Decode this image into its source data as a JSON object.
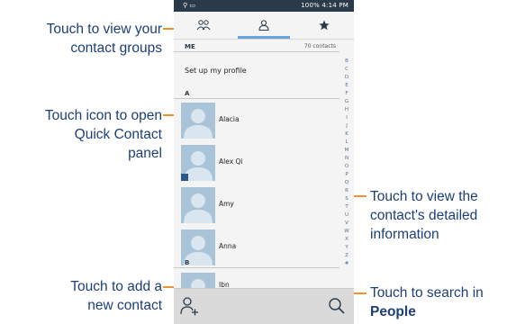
{
  "status_bar": {
    "right_text": "100%  4:14 PM"
  },
  "tabs": [
    {
      "icon": "group-icon",
      "label": "Groups"
    },
    {
      "icon": "person-icon",
      "label": "Contacts",
      "active": true
    },
    {
      "icon": "star-icon",
      "label": "Favorites"
    }
  ],
  "list": {
    "me_header": "ME",
    "me_count": "70 contacts",
    "profile_text": "Set up my profile",
    "section_a": "A",
    "section_b": "B",
    "contacts": [
      "Alacia",
      "Alex Qi",
      "Amy",
      "Anna"
    ],
    "last_partial": "Ibn",
    "alpha_index": [
      "B",
      "C",
      "D",
      "E",
      "F",
      "G",
      "H",
      "I",
      "J",
      "K",
      "L",
      "M",
      "N",
      "O",
      "P",
      "Q",
      "R",
      "S",
      "T",
      "U",
      "V",
      "W",
      "X",
      "Y",
      "Z",
      "#"
    ]
  },
  "bottom_bar": {
    "add_icon": "add-contact-icon",
    "search_icon": "search-icon"
  },
  "callouts": {
    "groups": [
      "Touch to view your",
      "contact groups"
    ],
    "quick_contact": [
      "Touch icon to open",
      "Quick Contact",
      "panel"
    ],
    "details": [
      "Touch to view the",
      "contact's detailed",
      "information"
    ],
    "add_contact": [
      "Touch to add a",
      "new contact"
    ],
    "search": [
      "Touch to search in"
    ],
    "search_bold": "People"
  },
  "colors": {
    "callout_text": "#1d3f77",
    "leader": "#f0922f",
    "accent": "#6aa3d9",
    "avatar_bg": "#a9c3d8"
  }
}
